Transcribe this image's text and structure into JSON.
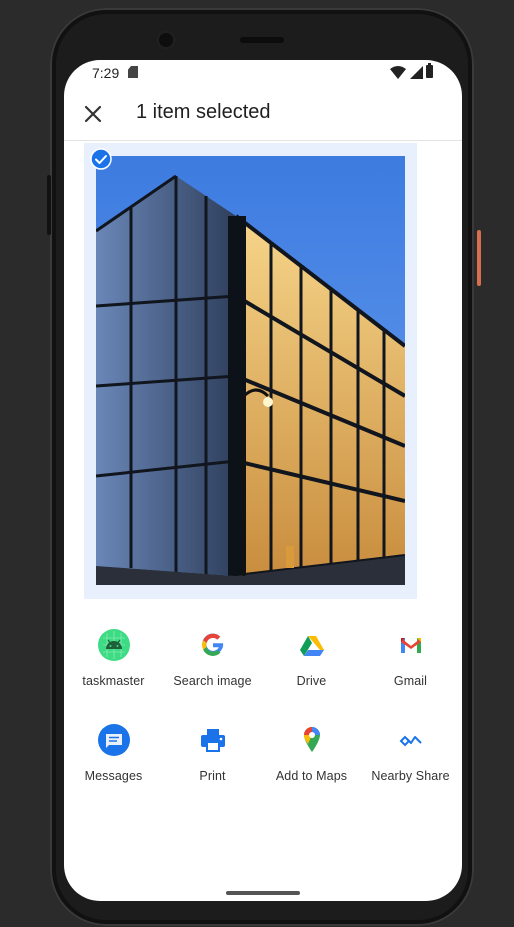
{
  "status_bar": {
    "time": "7:29"
  },
  "header": {
    "title": "1 item selected"
  },
  "preview": {
    "selected": true
  },
  "share_targets": [
    {
      "label": "taskmaster",
      "icon": "android-icon"
    },
    {
      "label": "Search image",
      "icon": "google-g-icon"
    },
    {
      "label": "Drive",
      "icon": "drive-icon"
    },
    {
      "label": "Gmail",
      "icon": "gmail-icon"
    },
    {
      "label": "Messages",
      "icon": "messages-icon"
    },
    {
      "label": "Print",
      "icon": "printer-icon"
    },
    {
      "label": "Add to Maps",
      "icon": "maps-pin-icon"
    },
    {
      "label": "Nearby Share",
      "icon": "nearby-share-icon"
    }
  ],
  "colors": {
    "accent": "#1a73e8",
    "preview_bg": "#e8f0fe",
    "android_green": "#3ddc84",
    "device_accent": "#d66f50"
  }
}
